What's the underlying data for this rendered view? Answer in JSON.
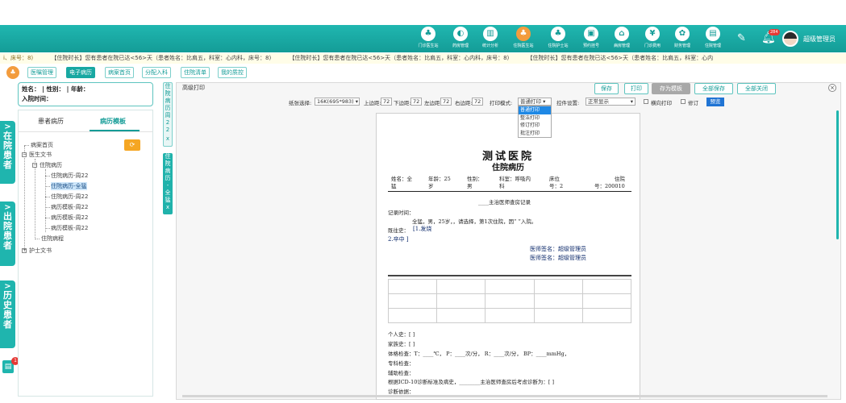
{
  "nav": {
    "items": [
      {
        "label": "门诊医生站",
        "icon": "doctor-icon",
        "glyph": "♣"
      },
      {
        "label": "药房管理",
        "icon": "pill-icon",
        "glyph": "◐"
      },
      {
        "label": "统计分析",
        "icon": "bar-chart-icon",
        "glyph": "▥"
      },
      {
        "label": "住院医生站",
        "icon": "inpatient-doctor-icon",
        "glyph": "♣",
        "active": true
      },
      {
        "label": "住院护士站",
        "icon": "nurse-icon",
        "glyph": "♣"
      },
      {
        "label": "预约挂号",
        "icon": "calendar-icon",
        "glyph": "▣"
      },
      {
        "label": "病房管理",
        "icon": "ward-icon",
        "glyph": "⌂"
      },
      {
        "label": "门诊费用",
        "icon": "fee-icon",
        "glyph": "¥"
      },
      {
        "label": "财务管理",
        "icon": "finance-icon",
        "glyph": "✿"
      },
      {
        "label": "住院管理",
        "icon": "hospital-admin-icon",
        "glyph": "▤"
      }
    ],
    "bell_count": "284",
    "user_name": "超级管理员"
  },
  "ticker": {
    "prefix": "i、床号：8)",
    "messages": [
      "【住院时长】您有患者在院已达<56>天（患者姓名：比肩五，科室：心内科，床号：8)",
      "【住院时长】您有患者在院已达<56>天（患者姓名：比肩五，科室：心内科，床号：8)",
      "【住院时长】您有患者在院已达<56>天（患者姓名：比肩五，科室：心内"
    ]
  },
  "top_tabs": [
    "医嘱管理",
    "电子病历",
    "病案首页",
    "分配入科",
    "住院清单",
    "我的质控"
  ],
  "rails": {
    "in": "在院患者",
    "out": "出院患者",
    "history": "历史患者",
    "bottom_badge": "1"
  },
  "patient": {
    "line1": "姓名：  | 性别：  | 年龄：",
    "line2": "入院时间："
  },
  "left_tabs": {
    "tab1": "患者病历",
    "tab2": "病历模板"
  },
  "tree": {
    "root": "病案首页",
    "doctor_docs": "医生文书",
    "inpatient_record": "住院病历",
    "items": [
      "住院病历-周22",
      "住院病历-全猛",
      "住院病历-周22",
      "病历模板-周22",
      "病历模板-周22",
      "病历模板-周22"
    ],
    "process": "住院病程",
    "nurse_docs": "护士文书"
  },
  "vtabs": {
    "tab1": "住院病历",
    "tab1b": "周22",
    "tab2": "住院病历-全猛"
  },
  "toolbar": {
    "title": "高级打印",
    "save": "保存",
    "print": "打印",
    "save_template": "存为模板",
    "save_all": "全部保存",
    "close_all": "全部关闭"
  },
  "options": {
    "paper_label": "纸张选择:",
    "paper_value": "16K(695*983)",
    "top_label": "上边距:",
    "top_value": "72",
    "bottom_label": "下边距:",
    "bottom_value": "72",
    "left_label": "左边距:",
    "left_value": "72",
    "right_label": "右边距:",
    "right_value": "72",
    "mode_label": "打印模式:",
    "mode_value": "普通打印",
    "mode_options": [
      "普通打印",
      "整洁打印",
      "修订打印",
      "批注打印"
    ],
    "ctrl_label": "控件设置:",
    "ctrl_value": "正常显示",
    "landscape": "横向打印",
    "revise": "修订",
    "preview": "预览"
  },
  "paper": {
    "hospital": "测试医院",
    "title": "住院病历",
    "info": [
      {
        "label": "姓名：全",
        "label2": "猛"
      },
      {
        "label": "年龄：25",
        "label2": "岁"
      },
      {
        "label": "性别：",
        "label2": "男"
      },
      {
        "label": "科室：呼吸内",
        "label2": "科"
      },
      {
        "label": "床位",
        "label2": "号：2"
      },
      {
        "label": "住院",
        "label2": "号：200010"
      }
    ],
    "section": "____主治医师查房记录",
    "record_time": "记录时间：",
    "complaint": "全猛，男，25岁，，请选择，第1次住院，因“ ”入院。",
    "history_label": "既往史：",
    "history_1": "[1.发烧",
    "history_2": "2.卒中 ]",
    "sign1": "医师签名：超级管理员",
    "sign2": "医师签名：超级管理员",
    "personal": "个人史：[ ]",
    "family": "家族史：[ ]",
    "exam": "体格检查：T：____℃， P：____次/分， R：____次/分， BP：____mmHg，",
    "special": "专科检查：",
    "aux": "辅助检查：",
    "diag_basis": "根据ICD-10诊断标准及病史，________主治医师查房后考虑诊断为：[ ]",
    "diag": "诊断依据："
  }
}
